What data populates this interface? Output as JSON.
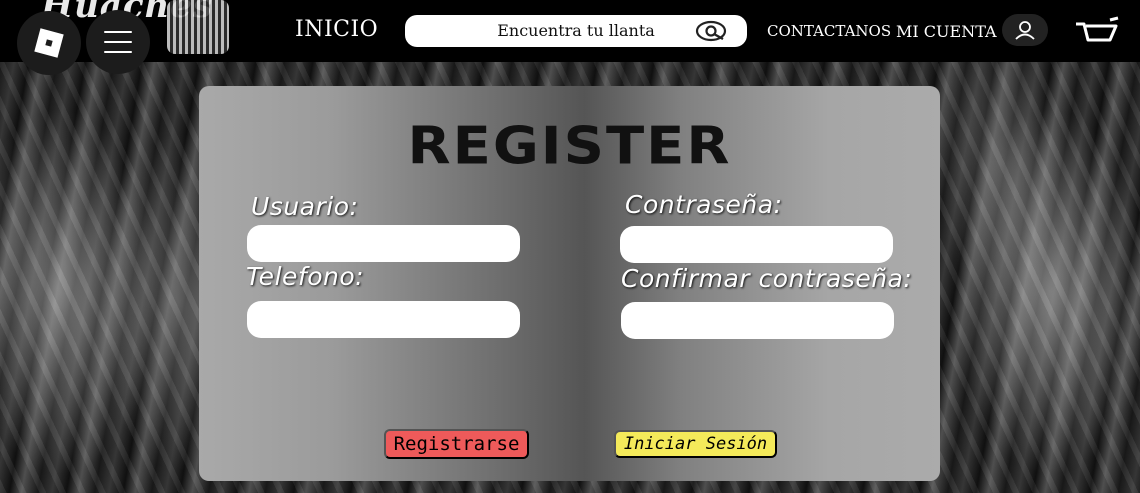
{
  "header": {
    "logo_text": "Huachés",
    "nav_home": "INICIO",
    "search_placeholder": "Encuentra tu llanta",
    "nav_contact": "CONTACTANOS",
    "nav_account": "MI CUENTA"
  },
  "form": {
    "title": "REGISTER",
    "labels": {
      "user": "Usuario:",
      "password": "Contraseña:",
      "phone": "Telefono:",
      "confirm": "Confirmar contraseña:"
    },
    "values": {
      "user": "",
      "password": "",
      "phone": "",
      "confirm": ""
    },
    "register_button": "Registrarse",
    "login_button": "Iniciar Sesión"
  },
  "colors": {
    "register_button": "#ee5a5a",
    "login_button": "#f4ea5a",
    "header_bg": "#000000"
  },
  "icons": [
    "roblox-icon",
    "menu-icon",
    "search-icon",
    "user-icon",
    "cart-icon"
  ]
}
